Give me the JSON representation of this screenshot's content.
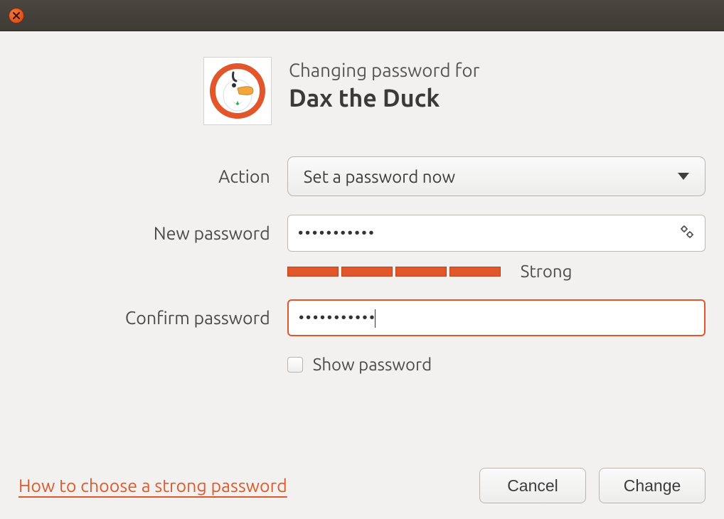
{
  "window": {
    "close_tooltip": "Close"
  },
  "header": {
    "subtitle": "Changing password for",
    "title": "Dax the Duck",
    "avatar_alt": "DuckDuckGo mascot avatar"
  },
  "form": {
    "action": {
      "label": "Action",
      "selected": "Set a password now"
    },
    "new_password": {
      "label": "New password",
      "value_masked": "•••••••••••",
      "gear_tooltip": "Generate password"
    },
    "strength": {
      "segments": 4,
      "label": "Strong",
      "color": "#e1562b"
    },
    "confirm_password": {
      "label": "Confirm password",
      "value_masked": "•••••••••••"
    },
    "show_password": {
      "label": "Show password",
      "checked": false
    }
  },
  "footer": {
    "help_link": "How to choose a strong password",
    "cancel": "Cancel",
    "change": "Change"
  }
}
